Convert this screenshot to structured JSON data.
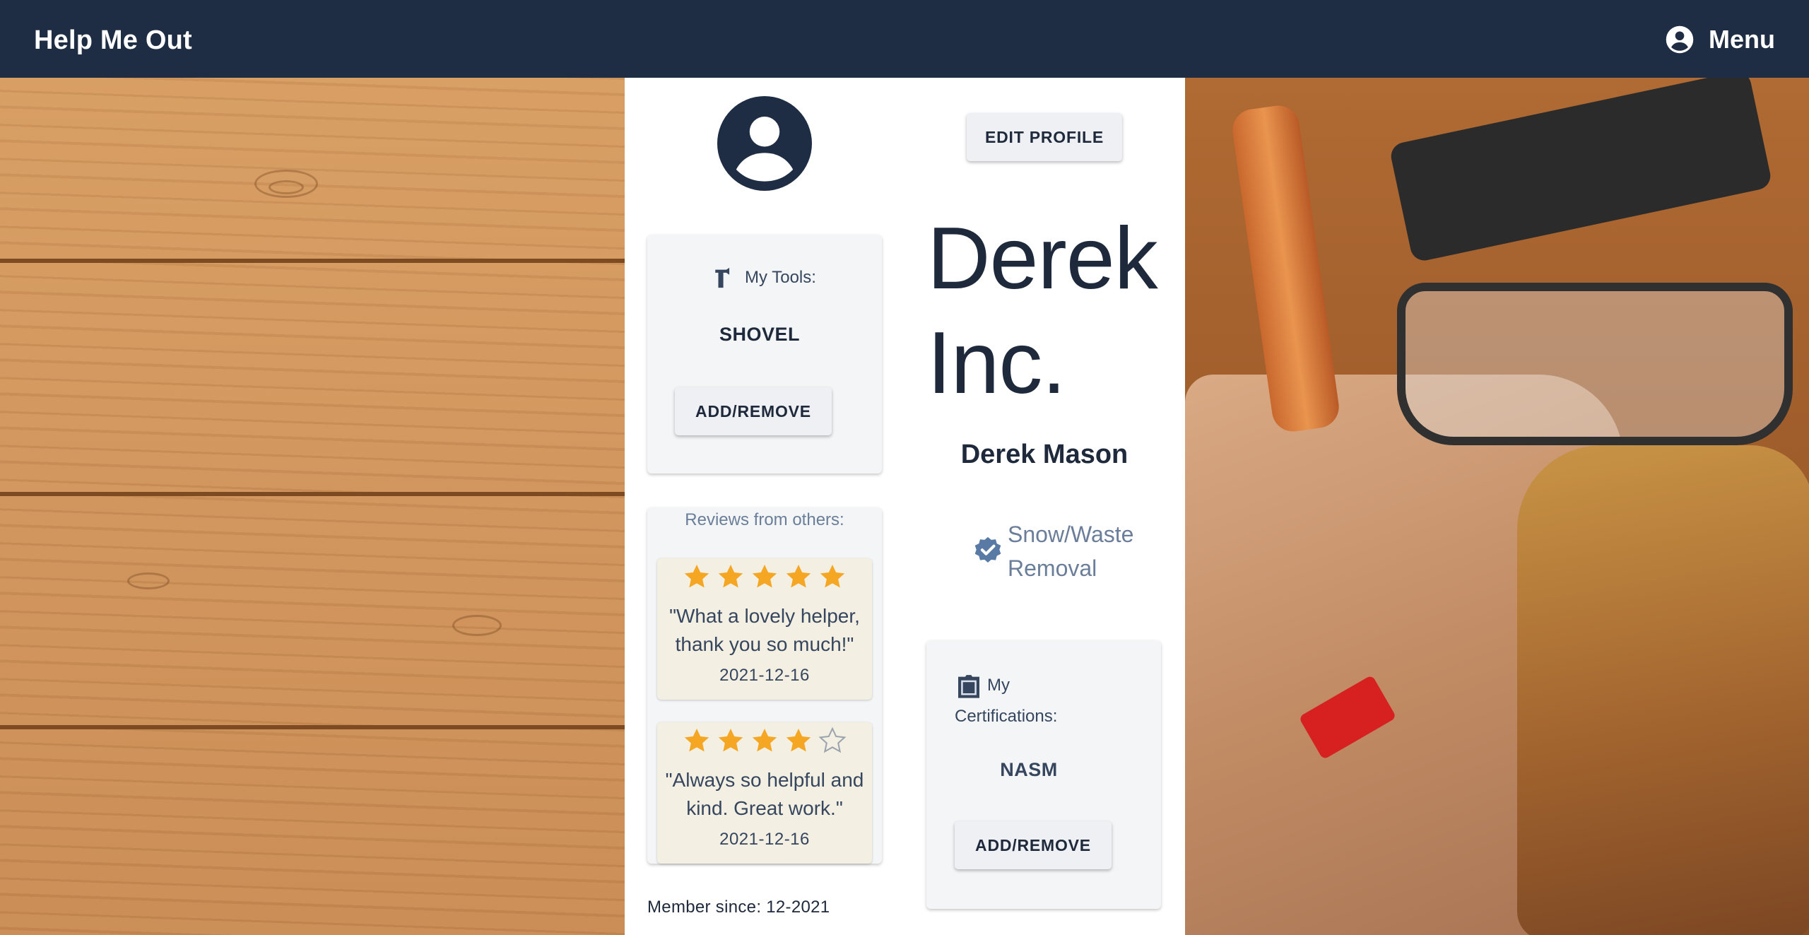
{
  "app": {
    "title": "Help Me Out",
    "menu_label": "Menu"
  },
  "profile": {
    "edit_label": "EDIT PROFILE",
    "company": "Derek Inc.",
    "company_line1": "Derek",
    "company_line2": "Inc.",
    "name": "Derek Mason",
    "specialty_line1": "Snow/Waste",
    "specialty_line2": "Removal",
    "member_since": "Member since: 12-2021"
  },
  "tools": {
    "title": "My Tools:",
    "items": [
      "SHOVEL"
    ],
    "action_label": "ADD/REMOVE"
  },
  "reviews": {
    "title": "Reviews from others:",
    "items": [
      {
        "rating": 5,
        "max": 5,
        "text": "\"What a lovely helper, thank you so much!\"",
        "date": "2021-12-16"
      },
      {
        "rating": 4,
        "max": 5,
        "text": "\"Always so helpful and kind. Great work.\"",
        "date": "2021-12-16"
      }
    ]
  },
  "certifications": {
    "title_line1": "My",
    "title_line2": "Certifications:",
    "items": [
      "NASM"
    ],
    "action_label": "ADD/REMOVE"
  },
  "colors": {
    "topbar": "#1f2d44",
    "text_dark": "#1e2a3c",
    "text_muted": "#6a7e9a",
    "star": "#f5a623",
    "card_bg": "#f3f5f7",
    "review_bg": "#f3efe2"
  },
  "icons": [
    "account-circle-icon",
    "hammer-icon",
    "star-icon",
    "star-outline-icon",
    "verified-icon",
    "certificate-icon"
  ]
}
